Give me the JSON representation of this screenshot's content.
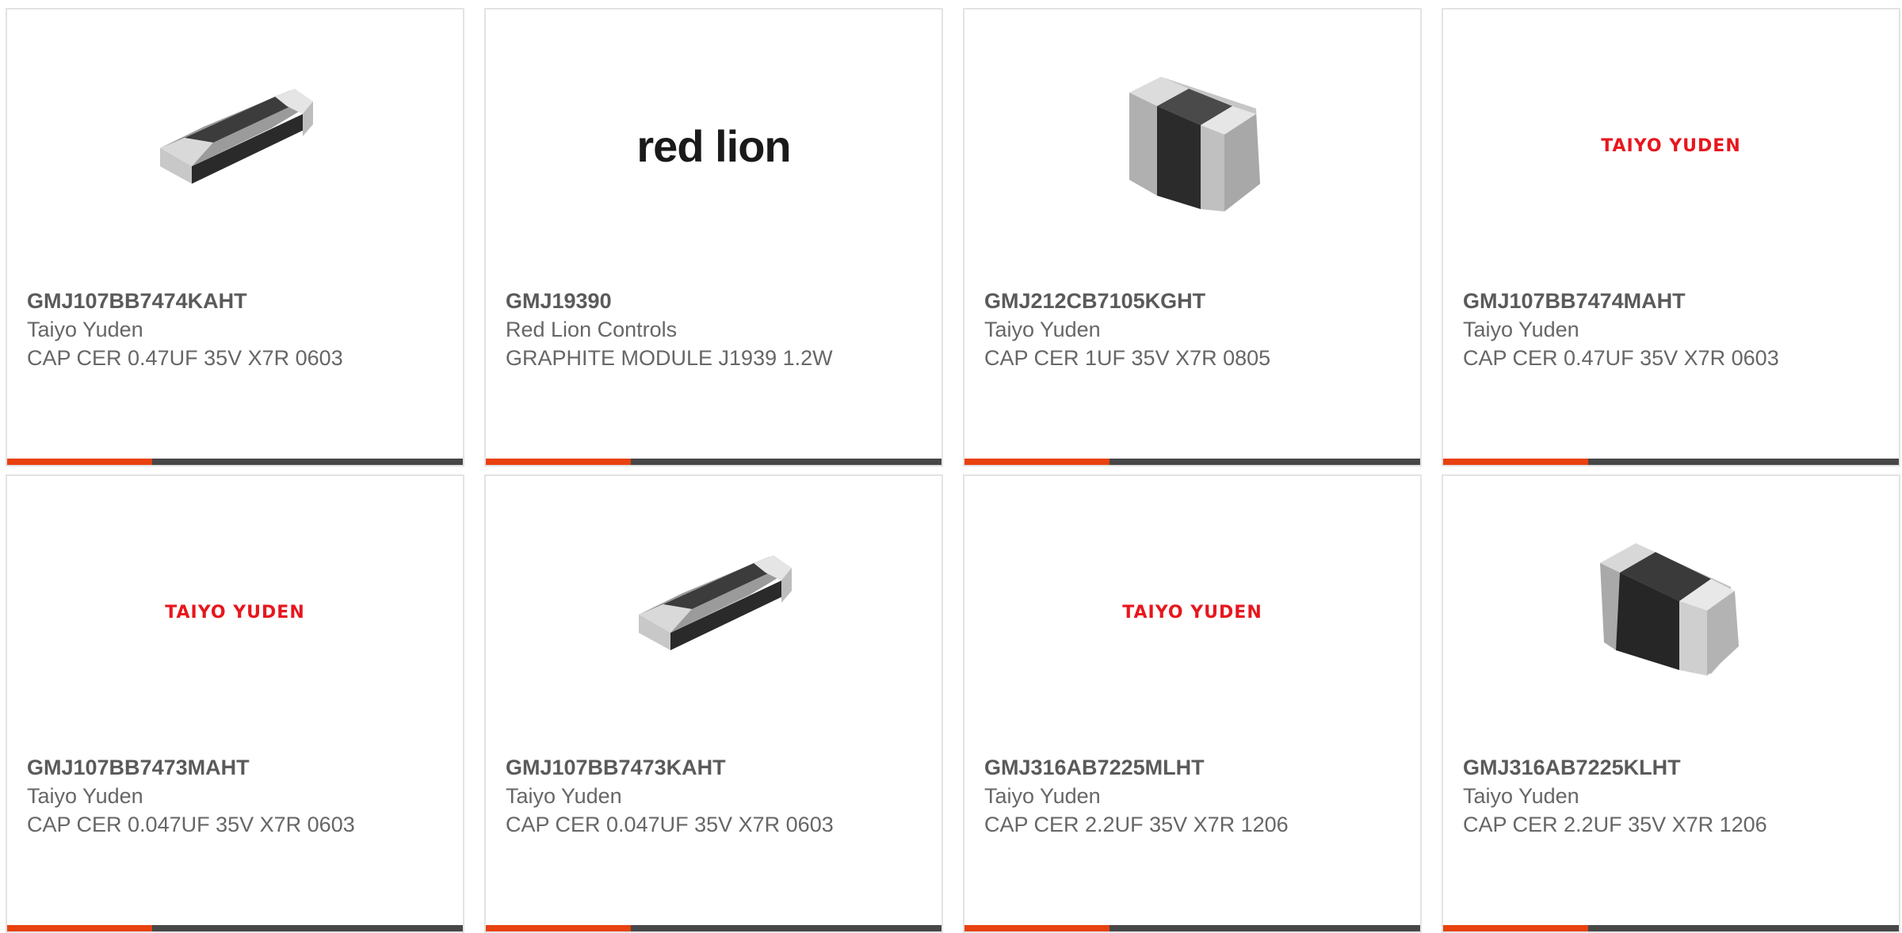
{
  "products": [
    {
      "part": "GMJ107BB7474KAHT",
      "maker": "Taiyo Yuden",
      "desc": "CAP CER 0.47UF 35V X7R 0603",
      "image": "capacitor-chip-flat"
    },
    {
      "part": "GMJ19390",
      "maker": "Red Lion Controls",
      "desc": "GRAPHITE MODULE J1939 1.2W",
      "image": "red-lion-logo",
      "logo_text": "red lion"
    },
    {
      "part": "GMJ212CB7105KGHT",
      "maker": "Taiyo Yuden",
      "desc": "CAP CER 1UF 35V X7R 0805",
      "image": "capacitor-chip-upright"
    },
    {
      "part": "GMJ107BB7474MAHT",
      "maker": "Taiyo Yuden",
      "desc": "CAP CER 0.47UF 35V X7R 0603",
      "image": "taiyo-yuden-logo",
      "logo_text": "TAIYO YUDEN"
    },
    {
      "part": "GMJ107BB7473MAHT",
      "maker": "Taiyo Yuden",
      "desc": "CAP CER 0.047UF 35V X7R 0603",
      "image": "taiyo-yuden-logo",
      "logo_text": "TAIYO YUDEN"
    },
    {
      "part": "GMJ107BB7473KAHT",
      "maker": "Taiyo Yuden",
      "desc": "CAP CER 0.047UF 35V X7R 0603",
      "image": "capacitor-chip-flat"
    },
    {
      "part": "GMJ316AB7225MLHT",
      "maker": "Taiyo Yuden",
      "desc": "CAP CER 2.2UF 35V X7R 1206",
      "image": "taiyo-yuden-logo",
      "logo_text": "TAIYO YUDEN"
    },
    {
      "part": "GMJ316AB7225KLHT",
      "maker": "Taiyo Yuden",
      "desc": "CAP CER 2.2UF 35V X7R 1206",
      "image": "capacitor-chip-upright"
    }
  ],
  "colors": {
    "accent": "#e8410f",
    "bar": "#474747",
    "logo_red": "#e8161d"
  }
}
